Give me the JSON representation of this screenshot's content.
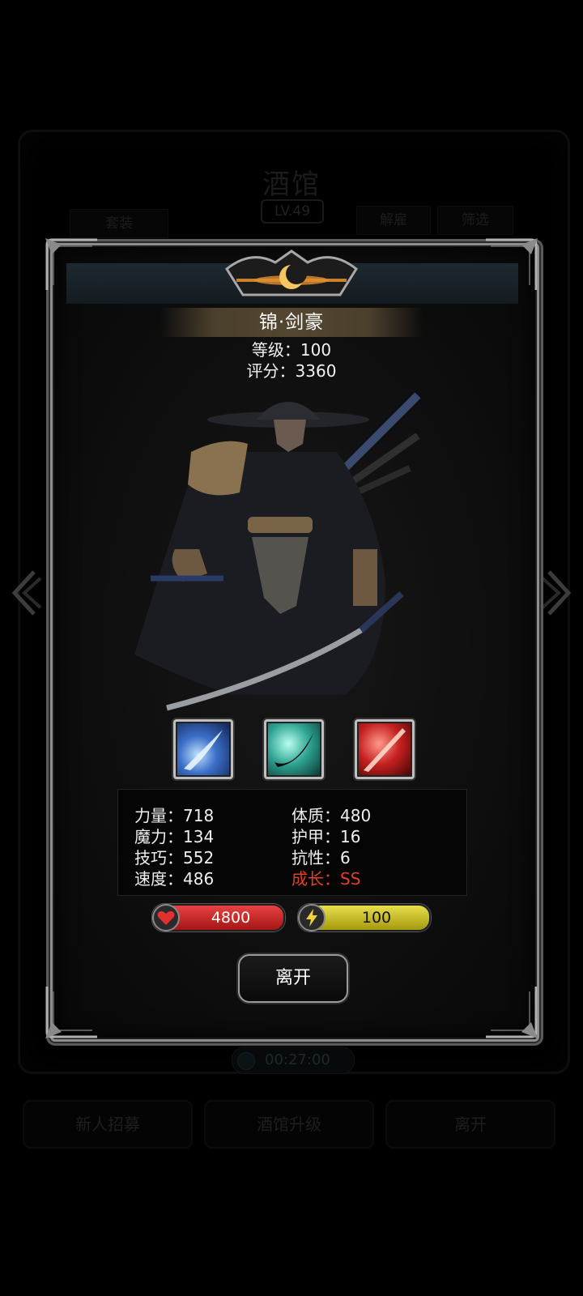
{
  "background": {
    "title": "酒馆",
    "level": "LV.49",
    "left_button": "套装",
    "right_buttons": [
      "解雇",
      "筛选"
    ],
    "timer": "00:27:00",
    "bottom_buttons": [
      "新人招募",
      "酒馆升级",
      "离开"
    ]
  },
  "hero": {
    "name": "锦·剑豪",
    "level_label": "等级：100",
    "score_label": "评分：3360"
  },
  "skills": [
    "blue-slash-icon",
    "cyan-slash-icon",
    "red-slash-icon"
  ],
  "stats": {
    "strength": "力量：718",
    "magic": "魔力：134",
    "skill": "技巧：552",
    "speed": "速度：486",
    "constitution": "体质：480",
    "armor": "护甲：16",
    "resistance": "抗性：6",
    "growth": "成长：SS"
  },
  "bars": {
    "hp": "4800",
    "energy": "100"
  },
  "leave_button": "离开",
  "colors": {
    "growth": "#e2411f",
    "hp": "#d32b2b",
    "energy": "#d6cc2e"
  }
}
